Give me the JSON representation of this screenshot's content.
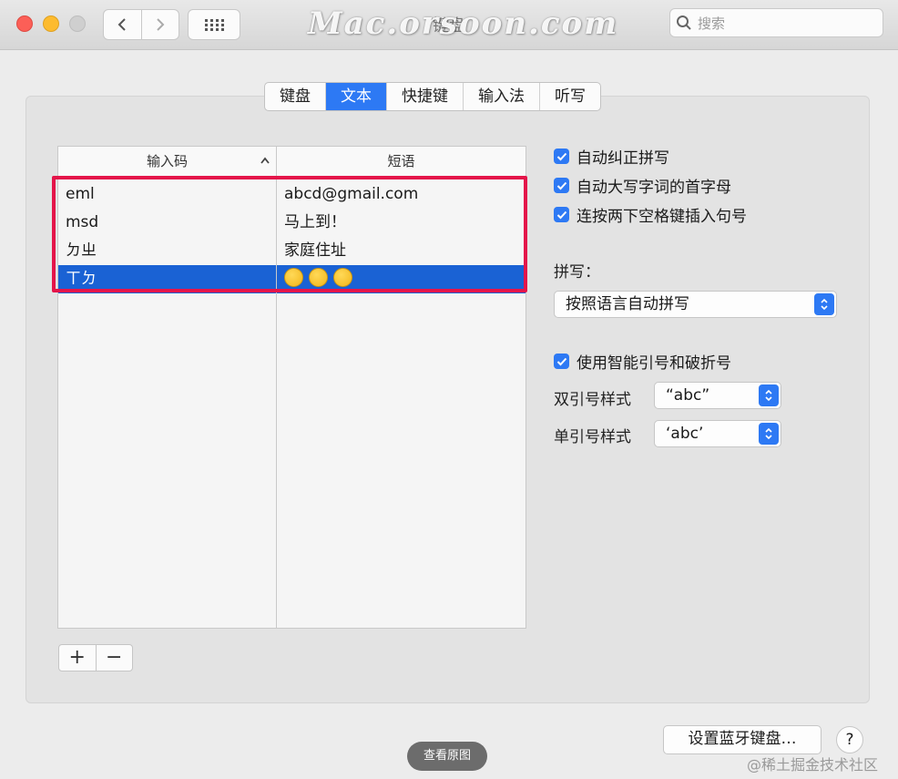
{
  "window": {
    "title": "键盘",
    "watermark": "Mac.orsoon.com",
    "search_placeholder": "搜索",
    "traffic_lights": {
      "close": "#fc5f57",
      "minimize": "#fdbb2e",
      "zoom": "#cfcfcf"
    }
  },
  "tabs": [
    {
      "label": "键盘",
      "active": false
    },
    {
      "label": "文本",
      "active": true
    },
    {
      "label": "快捷键",
      "active": false
    },
    {
      "label": "输入法",
      "active": false
    },
    {
      "label": "听写",
      "active": false
    }
  ],
  "table": {
    "headers": {
      "code": "输入码",
      "phrase": "短语"
    },
    "rows": [
      {
        "code": "eml",
        "phrase": "abcd@gmail.com",
        "selected": false
      },
      {
        "code": "msd",
        "phrase": "马上到！",
        "selected": false
      },
      {
        "code": "ㄉㄓ",
        "phrase": "家庭住址",
        "selected": false
      },
      {
        "code": "ㄒㄉ",
        "phrase": "",
        "emoji": [
          "grinning-sweat-face",
          "grinning-sweat-face",
          "grinning-sweat-face"
        ],
        "selected": true
      }
    ],
    "add_label": "+",
    "remove_label": "−"
  },
  "options": {
    "autocorrect": {
      "label": "自动纠正拼写",
      "checked": true
    },
    "capitalize": {
      "label": "自动大写字词的首字母",
      "checked": true
    },
    "period": {
      "label": "连按两下空格键插入句号",
      "checked": true
    },
    "spelling_label": "拼写：",
    "spelling_value": "按照语言自动拼写",
    "smart_quotes": {
      "label": "使用智能引号和破折号",
      "checked": true
    },
    "double_quote_label": "双引号样式",
    "double_quote_value": "“abc”",
    "single_quote_label": "单引号样式",
    "single_quote_value": "‘abc’"
  },
  "footer": {
    "bluetooth_button": "设置蓝牙键盘…",
    "help": "?",
    "view_original": "查看原图",
    "credit": "@稀土掘金技术社区"
  },
  "colors": {
    "accent": "#2d79f4",
    "selection": "#1a62d4",
    "highlight_border": "#e4154a"
  }
}
